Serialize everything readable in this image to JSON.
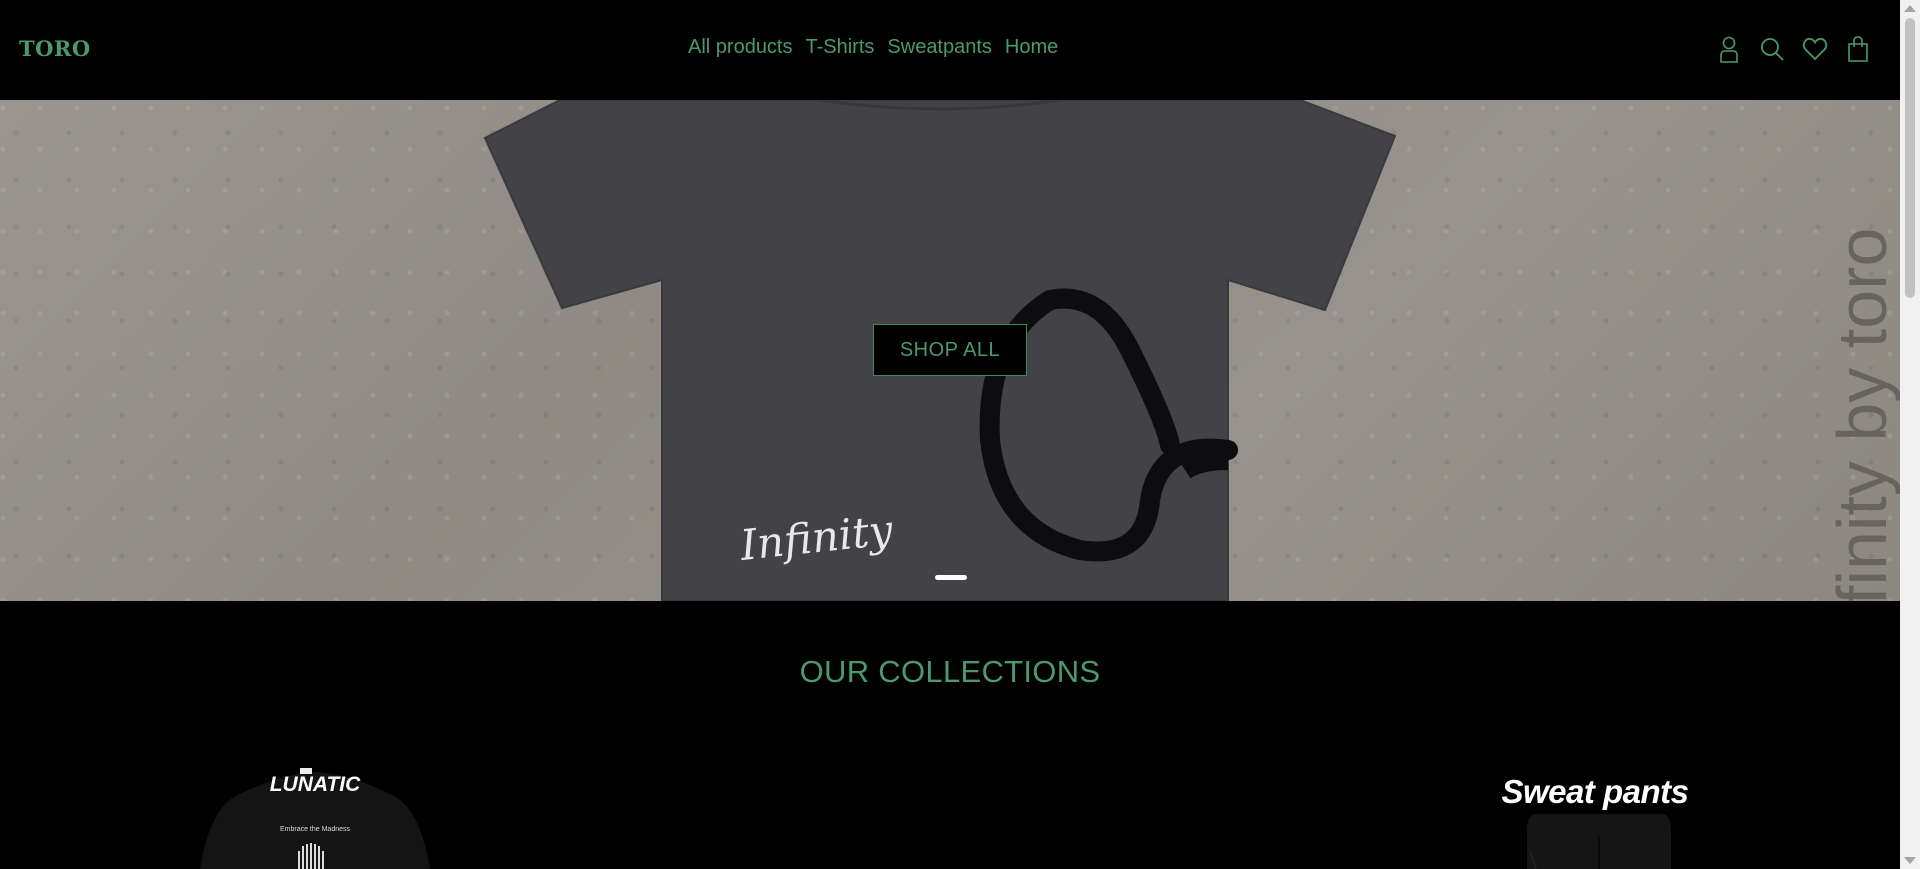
{
  "colors": {
    "accent": "#4a9a6b",
    "background": "#000000"
  },
  "header": {
    "logo": "TORO",
    "nav": [
      "All products",
      "T-Shirts",
      "Sweatpants",
      "Home"
    ],
    "icons": [
      "account-icon",
      "search-icon",
      "wishlist-heart-icon",
      "shopping-bag-icon"
    ]
  },
  "hero": {
    "button_label": "SHOP ALL",
    "shirt_script": "Infinity",
    "side_text": "finity by toro",
    "active_slide": 1
  },
  "collections": {
    "title": "OUR COLLECTIONS",
    "cards": [
      {
        "title": "LUNATIC",
        "subtitle": "Embrace the Madness"
      },
      {
        "title": "Sweat pants"
      }
    ]
  }
}
